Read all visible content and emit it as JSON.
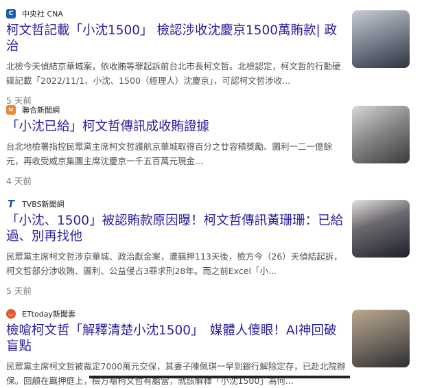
{
  "articles": [
    {
      "source": "中央社 CNA",
      "logo_icon": "cna-logo-icon",
      "logo_color": "#1f5fa8",
      "title": "柯文哲記載「小沈1500」 檢認涉收沈慶京1500萬賄款| 政治",
      "snippet": "北檢今天偵結京華城案，依收賄等罪起訴前台北市長柯文哲。北檢認定，柯文哲的行動硬碟記載「2022/11/1、小沈、1500（經理人）沈慶京」，可認柯文哲涉收...",
      "time": "5 天前"
    },
    {
      "source": "聯合新聞網",
      "logo_icon": "udn-logo-icon",
      "logo_color": "#e8893a",
      "title": "「小沈已給」柯文哲傳訊成收賄證據",
      "snippet": "台北地檢署指控民眾黨主席柯文哲護航京華城取得百分之廿容積獎勵、圖利一二一億餘元，再收受威京集團主席沈慶京一千五百萬元現金...",
      "time": "4 天前"
    },
    {
      "source": "TVBS新聞網",
      "logo_icon": "tvbs-logo-icon",
      "logo_color": "#1b4f9c",
      "title": "「小沈、1500」被認賄款原因曝！柯文哲傳訊黃珊珊：已給過、別再找他",
      "snippet": "民眾黨主席柯文哲涉京華城、政治獻金案，遭羈押113天後，檢方今（26）天偵結起訴，柯文哲部分涉收賄、圖利、公益侵占3罪求刑28年。而之前Excel「小...",
      "time": "5 天前"
    },
    {
      "source": "ETtoday新聞雲",
      "logo_icon": "ettoday-logo-icon",
      "logo_color": "#e4572e",
      "title": "檢嗆柯文哲「解釋清楚小沈1500」　媒體人傻眼！AI神回破盲點",
      "snippet": "民眾黨主席柯文哲被裁定7000萬元交保，其妻子陳佩琪一早到銀行解除定存，已赴北院辦保。回顧在羈押庭上，檢方嗆柯文哲有膽當，就該解釋「小沈1500」為何..."
    }
  ]
}
